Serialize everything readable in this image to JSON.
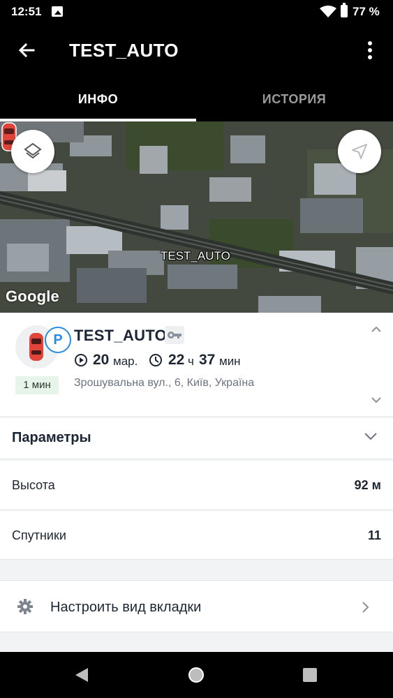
{
  "status_bar": {
    "time": "12:51",
    "battery": "77 %"
  },
  "app_bar": {
    "title": "TEST_AUTO"
  },
  "tabs": [
    {
      "label": "ИНФО",
      "active": true
    },
    {
      "label": "ИСТОРИЯ",
      "active": false
    }
  ],
  "map": {
    "vehicle_label": "TEST_AUTO",
    "attribution": "Google"
  },
  "vehicle": {
    "name": "TEST_AUTO",
    "parking_badge": "P",
    "age_badge": "1 мин",
    "date_day": "20",
    "date_month": "мар.",
    "duration_hours": "22",
    "duration_hours_unit": "ч",
    "duration_minutes": "37",
    "duration_minutes_unit": "мин",
    "address": "Зрошувальна вул., 6, Київ, Україна"
  },
  "parameters": {
    "title": "Параметры",
    "rows": [
      {
        "label": "Высота",
        "value": "92 м"
      },
      {
        "label": "Спутники",
        "value": "11"
      }
    ]
  },
  "configure": {
    "label": "Настроить вид вкладки"
  },
  "colors": {
    "accent_blue": "#2a8be0",
    "car_red": "#e0443a",
    "age_badge_bg": "#e6f4ea"
  }
}
